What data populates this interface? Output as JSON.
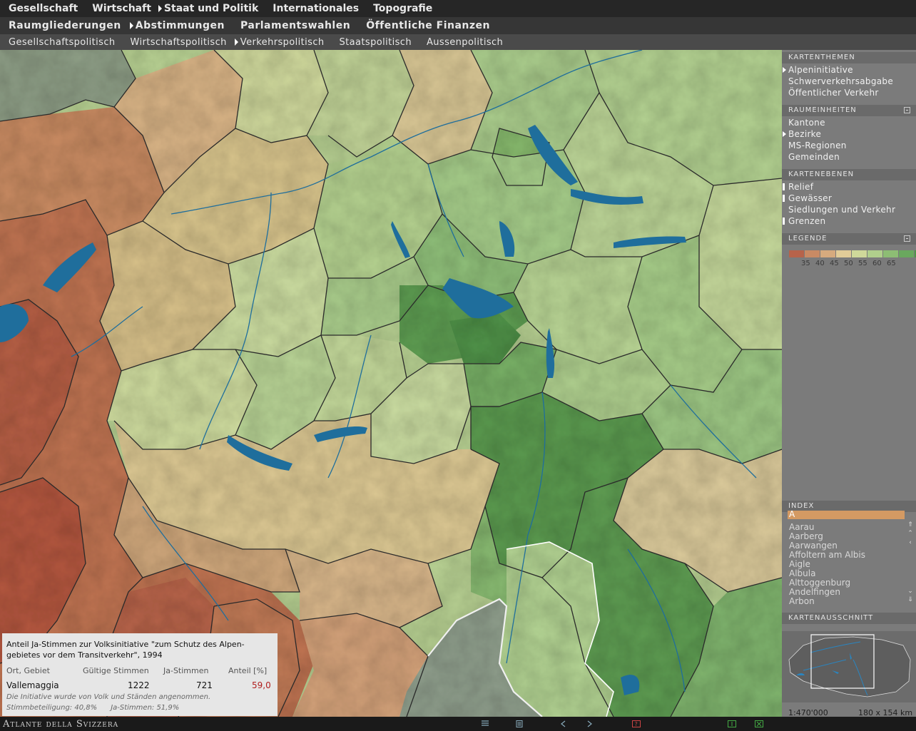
{
  "nav": {
    "level1": [
      "Gesellschaft",
      "Wirtschaft",
      "Staat und Politik",
      "Internationales",
      "Topografie"
    ],
    "level2": [
      "Raumgliederungen",
      "Abstimmungen",
      "Parlamentswahlen",
      "Öffentliche Finanzen"
    ],
    "level3": [
      "Gesellschaftspolitisch",
      "Wirtschaftspolitisch",
      "Verkehrspolitisch",
      "Staatspolitisch",
      "Aussenpolitisch"
    ]
  },
  "sidebar": {
    "kartenthemen": {
      "title": "KARTENTHEMEN",
      "items": [
        "Alpeninitiative",
        "Schwerverkehrsabgabe",
        "Öffentlicher Verkehr"
      ]
    },
    "raumeinheiten": {
      "title": "RAUMEINHEITEN",
      "items": [
        "Kantone",
        "Bezirke",
        "MS-Regionen",
        "Gemeinden"
      ]
    },
    "kartenebenen": {
      "title": "KARTENEBENEN",
      "items": [
        "Relief",
        "Gewässer",
        "Siedlungen und Verkehr",
        "Grenzen"
      ]
    },
    "legende": {
      "title": "LEGENDE",
      "colors": [
        "#b7634a",
        "#c98a64",
        "#d6aa7e",
        "#e2cc98",
        "#cfd89a",
        "#b0cf8c",
        "#8dbd74",
        "#6aa85e",
        "#4f9448"
      ],
      "labels": [
        "35",
        "40",
        "45",
        "50",
        "55",
        "60",
        "65"
      ]
    },
    "index": {
      "title": "INDEX",
      "selected": "A",
      "items": [
        "Aarau",
        "Aarberg",
        "Aarwangen",
        "Affoltern am Albis",
        "Aigle",
        "Albula",
        "Alttoggenburg",
        "Andelfingen",
        "Arbon"
      ]
    },
    "kartenausschnitt": {
      "title": "KARTENAUSSCHNITT",
      "scale": "1:470'000",
      "size": "180 x 154 km"
    }
  },
  "info": {
    "title": "Anteil Ja-Stimmen zur Volksinitiative \"zum Schutz des Alpengebietes vor dem Transitverkehr\", 1994",
    "title_line1": "Anteil Ja-Stimmen zur Volksinitiative \"zum Schutz des Alpen-",
    "title_line2": "gebietes vor dem Transitverkehr\", 1994",
    "headers": [
      "Ort, Gebiet",
      "Gültige Stimmen",
      "Ja-Stimmen",
      "Anteil [%]"
    ],
    "row": {
      "place": "Vallemaggia",
      "valid": "1222",
      "yes": "721",
      "share": "59,0"
    },
    "note1": "Die Initiative wurde von Volk und Ständen angenommen.",
    "note2": "Stimmbeteiligung: 40,8%      Ja-Stimmen: 51,9%"
  },
  "footer": {
    "brand": "Atlante della Svizzera"
  },
  "colors": {
    "lake": "#1f6e9c",
    "border": "#2a2a2a",
    "highlight": "#ffffff",
    "share_value": "#b01e1e"
  }
}
